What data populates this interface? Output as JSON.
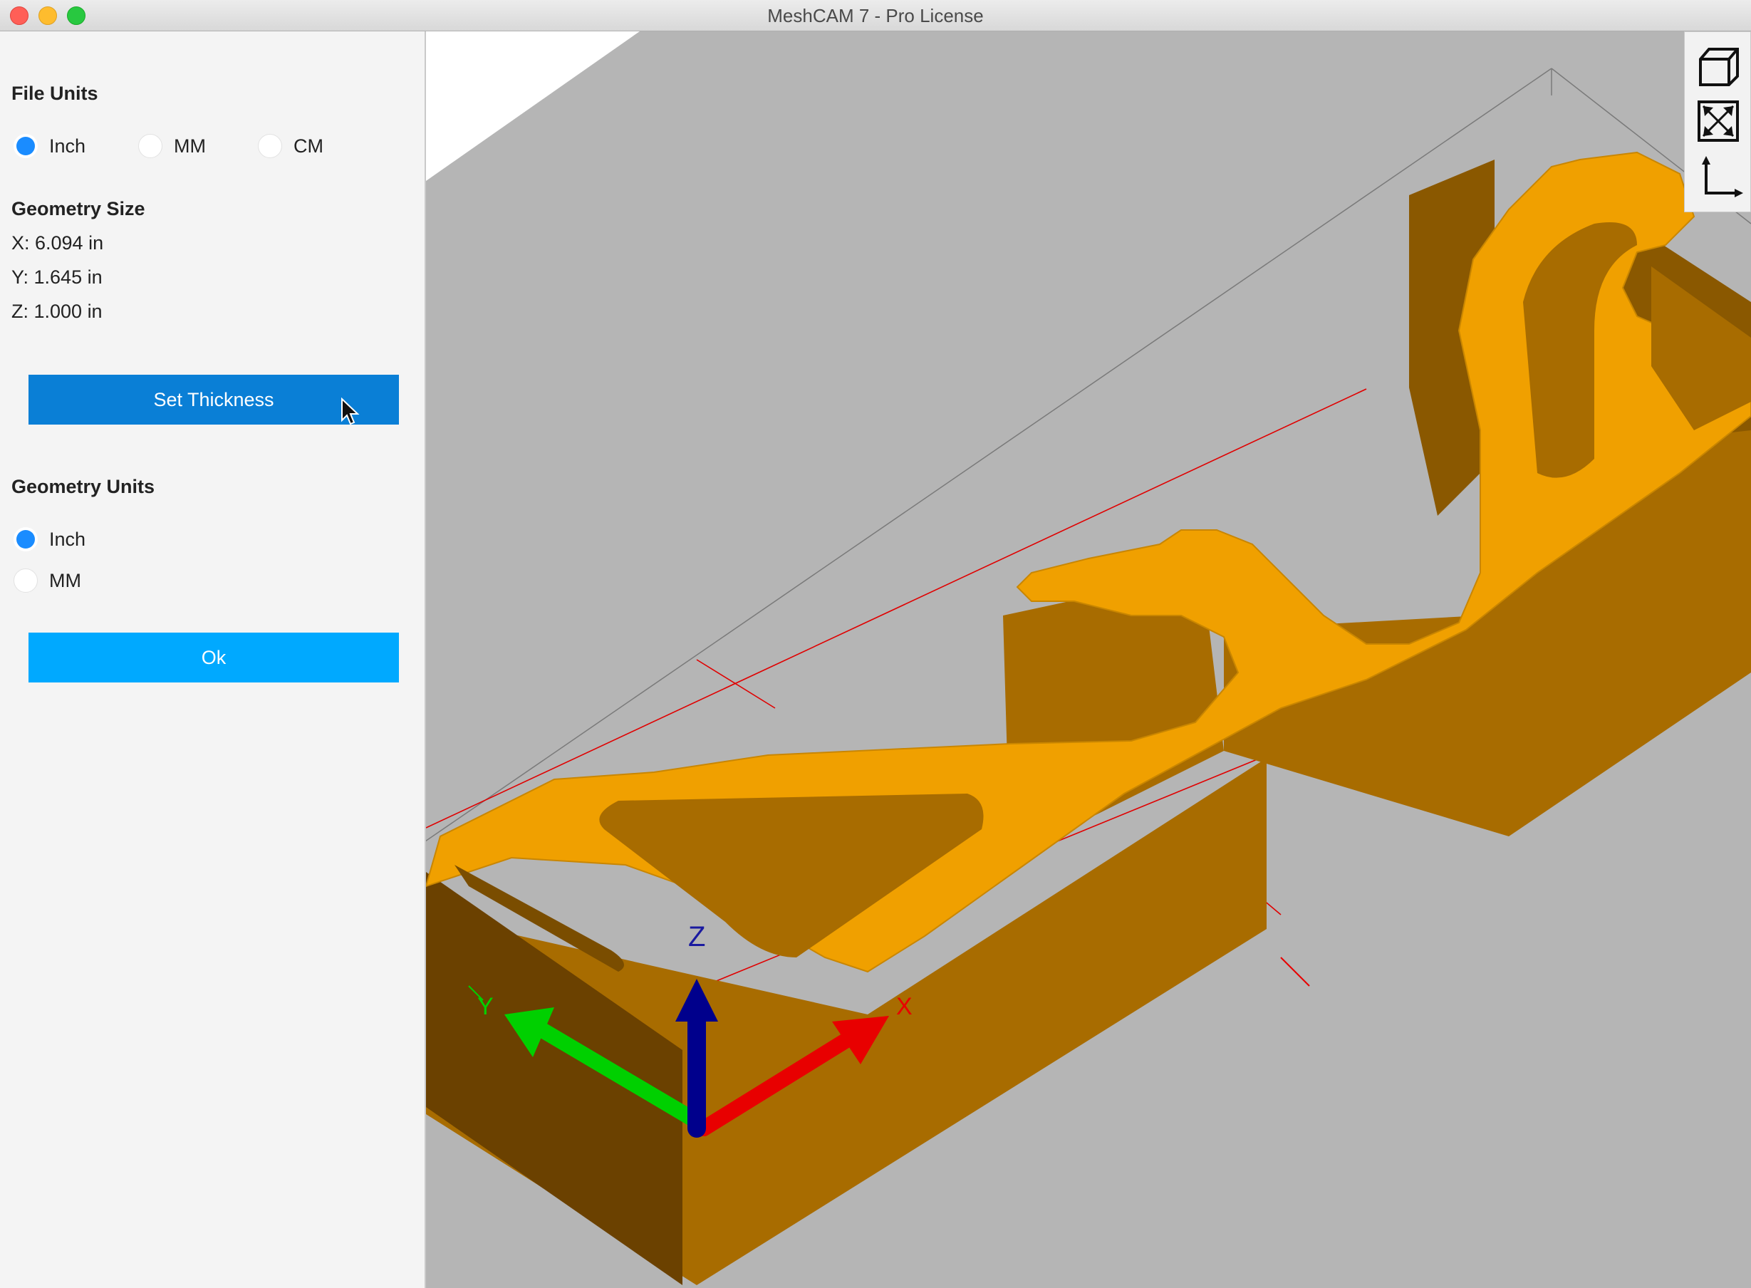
{
  "window": {
    "title": "MeshCAM 7 - Pro License"
  },
  "file_units": {
    "heading": "File Units",
    "options": [
      "Inch",
      "MM",
      "CM"
    ],
    "selected": "Inch"
  },
  "geometry_size": {
    "heading": "Geometry Size",
    "x": "X: 6.094 in",
    "y": "Y: 1.645 in",
    "z": "Z: 1.000 in"
  },
  "buttons": {
    "set_thickness": "Set Thickness",
    "ok": "Ok"
  },
  "geometry_units": {
    "heading": "Geometry Units",
    "options": [
      "Inch",
      "MM"
    ],
    "selected": "Inch"
  },
  "axes": {
    "x": "X",
    "y": "Y",
    "z": "Z"
  },
  "colors": {
    "accent_button": "#0a7fd6",
    "ok_button": "#00a9ff",
    "radio_selected": "#1a8cff",
    "model_top": "#f0a000",
    "model_side": "#a86c00",
    "axis_x": "#e80000",
    "axis_y": "#00d000",
    "axis_z": "#00008c",
    "background": "#b5b5b5"
  },
  "view_tools": [
    "iso-view-icon",
    "zoom-fit-icon",
    "axes-view-icon"
  ]
}
